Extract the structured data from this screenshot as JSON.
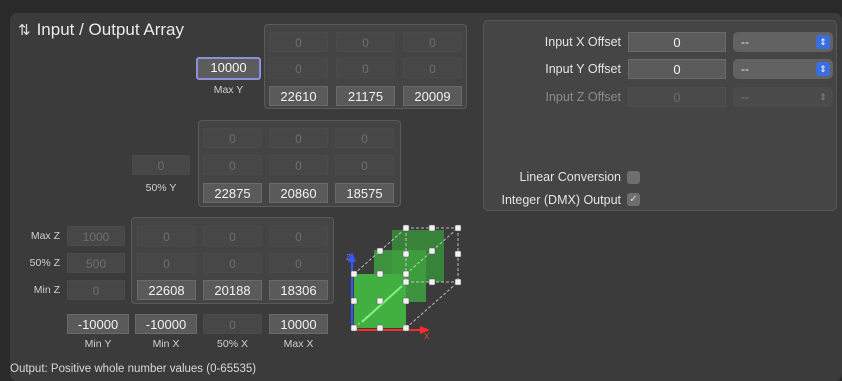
{
  "title": "Input / Output Array",
  "title_icon": "swap-vertical-arrows-icon",
  "top_grid": {
    "row1": [
      "0",
      "0",
      "0"
    ],
    "row2": [
      "0",
      "0",
      "0"
    ],
    "row3": [
      "22610",
      "21175",
      "20009"
    ],
    "max_y_value": "10000",
    "max_y_label": "Max Y"
  },
  "mid_grid": {
    "row1": [
      "0",
      "0",
      "0"
    ],
    "row2": [
      "0",
      "0",
      "0"
    ],
    "row3": [
      "22875",
      "20860",
      "18575"
    ],
    "half_y_value": "0",
    "half_y_label": "50% Y"
  },
  "bottom_grid": {
    "z_labels": [
      "Max Z",
      "50% Z",
      "Min Z"
    ],
    "z_values": [
      "1000",
      "500",
      "0"
    ],
    "row1": [
      "0",
      "0",
      "0"
    ],
    "row2": [
      "0",
      "0",
      "0"
    ],
    "row3": [
      "22608",
      "20188",
      "18306"
    ],
    "x_values": [
      "-10000",
      "-10000",
      "0",
      "10000"
    ],
    "x_labels": [
      "Min Y",
      "Min X",
      "50% X",
      "Max X"
    ]
  },
  "axis_labels": {
    "z": "Z",
    "x": "X"
  },
  "offsets": {
    "x": {
      "label": "Input X Offset",
      "value": "0",
      "select": "--"
    },
    "y": {
      "label": "Input Y Offset",
      "value": "0",
      "select": "--"
    },
    "z": {
      "label": "Input Z Offset",
      "value": "0",
      "select": "--"
    }
  },
  "linear_conversion": {
    "label": "Linear Conversion",
    "checked": false
  },
  "integer_output": {
    "label": "Integer (DMX) Output",
    "checked": true,
    "mark": "✓"
  },
  "footer": "Output: Positive whole number values (0-65535)",
  "colors": {
    "accent": "#3a6de0",
    "focus": "#8b8fdc",
    "cube": "#3fae3f"
  }
}
